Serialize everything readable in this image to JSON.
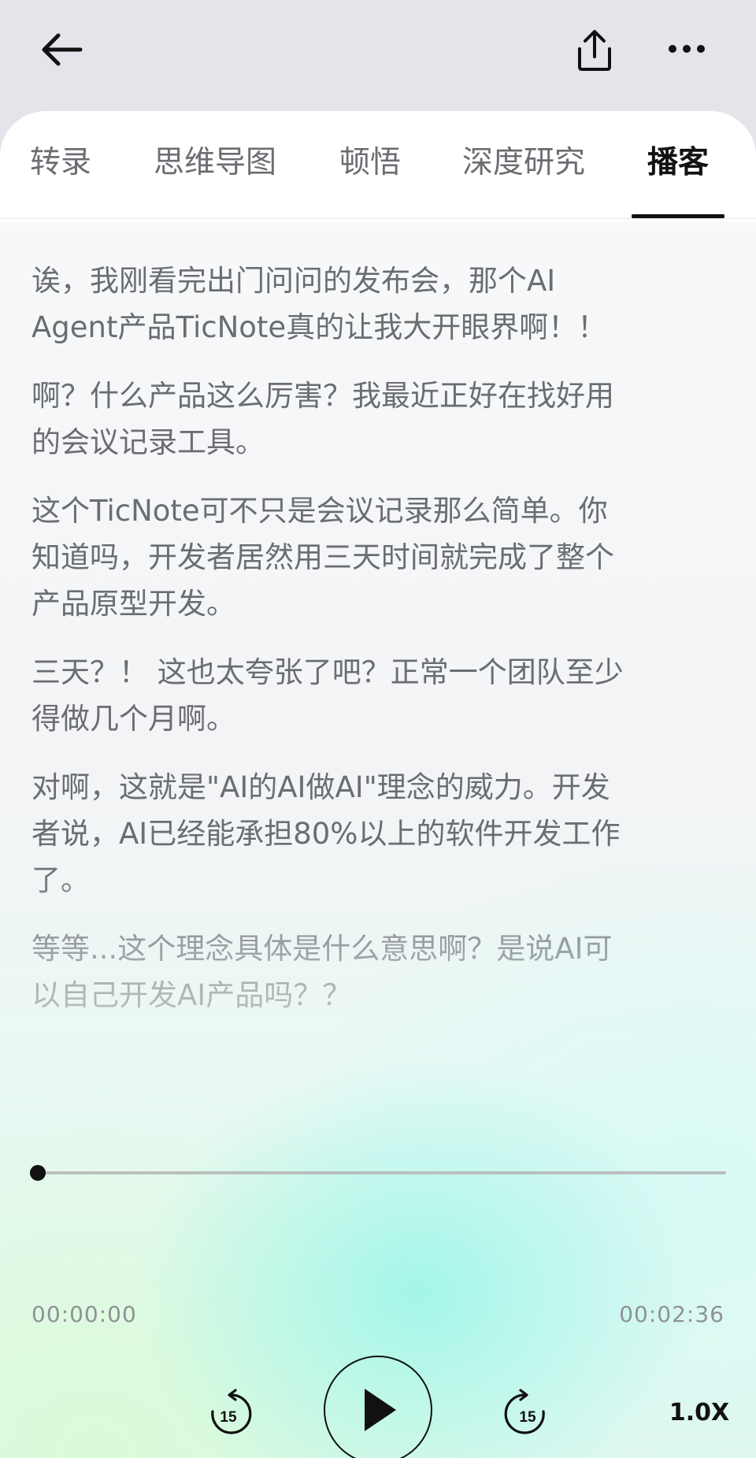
{
  "nav": {
    "icons": {
      "back": "arrow-left-icon",
      "share": "share-upload-icon",
      "more": "more-dots-icon"
    }
  },
  "tabs": [
    {
      "label": "转录"
    },
    {
      "label": "思维导图"
    },
    {
      "label": "顿悟"
    },
    {
      "label": "深度研究"
    },
    {
      "label": "播客",
      "active": true
    }
  ],
  "transcript": [
    "诶，我刚看完出门问问的发布会，那个AI Agent产品TicNote真的让我大开眼界啊！！",
    "啊？什么产品这么厉害？我最近正好在找好用的会议记录工具。",
    "这个TicNote可不只是会议记录那么简单。你知道吗，开发者居然用三天时间就完成了整个产品原型开发。",
    "三天？！ 这也太夸张了吧？正常一个团队至少得做几个月啊。",
    "对啊，这就是\"AI的AI做AI\"理念的威力。开发者说，AI已经能承担80%以上的软件开发工作了。",
    "等等...这个理念具体是什么意思啊？是说AI可以自己开发AI产品吗？？"
  ],
  "player": {
    "current_time": "00:00:00",
    "total_time": "00:02:36",
    "progress": 0,
    "rewind_label": "15",
    "forward_label": "15",
    "speed": "1.0X",
    "icons": {
      "rewind": "rewind-15-icon",
      "play": "play-icon",
      "forward": "forward-15-icon"
    }
  },
  "colors": {
    "text_primary": "#121212",
    "text_secondary": "#6a6d71",
    "header_bg": "#e3e5ea"
  }
}
